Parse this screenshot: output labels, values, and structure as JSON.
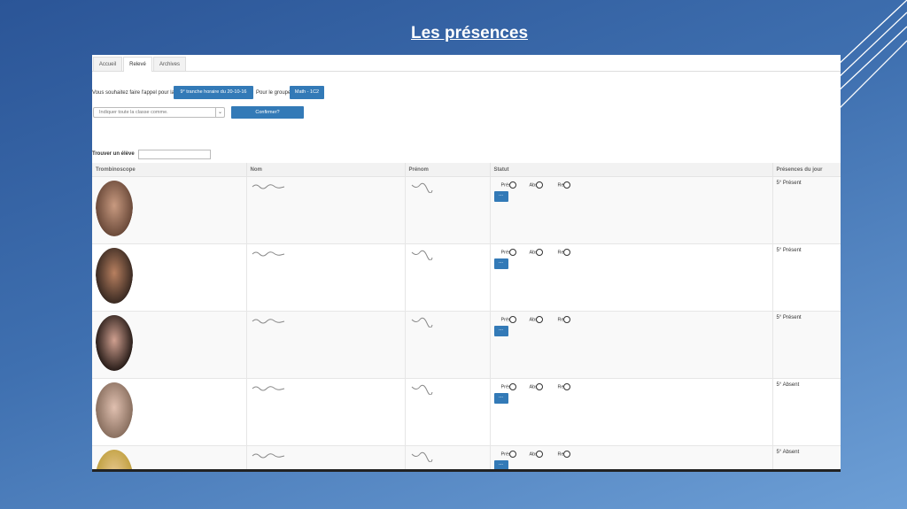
{
  "slide": {
    "title": "Les présences"
  },
  "tabs": [
    {
      "label": "Accueil",
      "active": false
    },
    {
      "label": "Relevé",
      "active": true
    },
    {
      "label": "Archives",
      "active": false
    }
  ],
  "form": {
    "intro": "Vous souhaitez faire l'appel pour la",
    "session_button": "9° tranche horaire du 20-10-16",
    "group_label": "Pour le groupe",
    "group_button": "Math - 1C2",
    "select_value": "Indiquer toute la classe comme.",
    "confirm_button": "Confirmer?"
  },
  "search": {
    "label": "Trouver un élève"
  },
  "table": {
    "headers": [
      "Trombinoscope",
      "Nom",
      "Prénom",
      "Statut",
      "Présences du jour"
    ],
    "status_options": [
      "Prés",
      "Abs",
      "Ret"
    ],
    "details_button": "...",
    "rows": [
      {
        "presence": "5° Présent"
      },
      {
        "presence": "5° Présent"
      },
      {
        "presence": "5° Présent"
      },
      {
        "presence": "5° Absent"
      },
      {
        "presence": "5° Absent"
      }
    ]
  },
  "colors": {
    "accent": "#337ab7",
    "background_top": "#2b5597",
    "background_bottom": "#6d9fd6"
  }
}
